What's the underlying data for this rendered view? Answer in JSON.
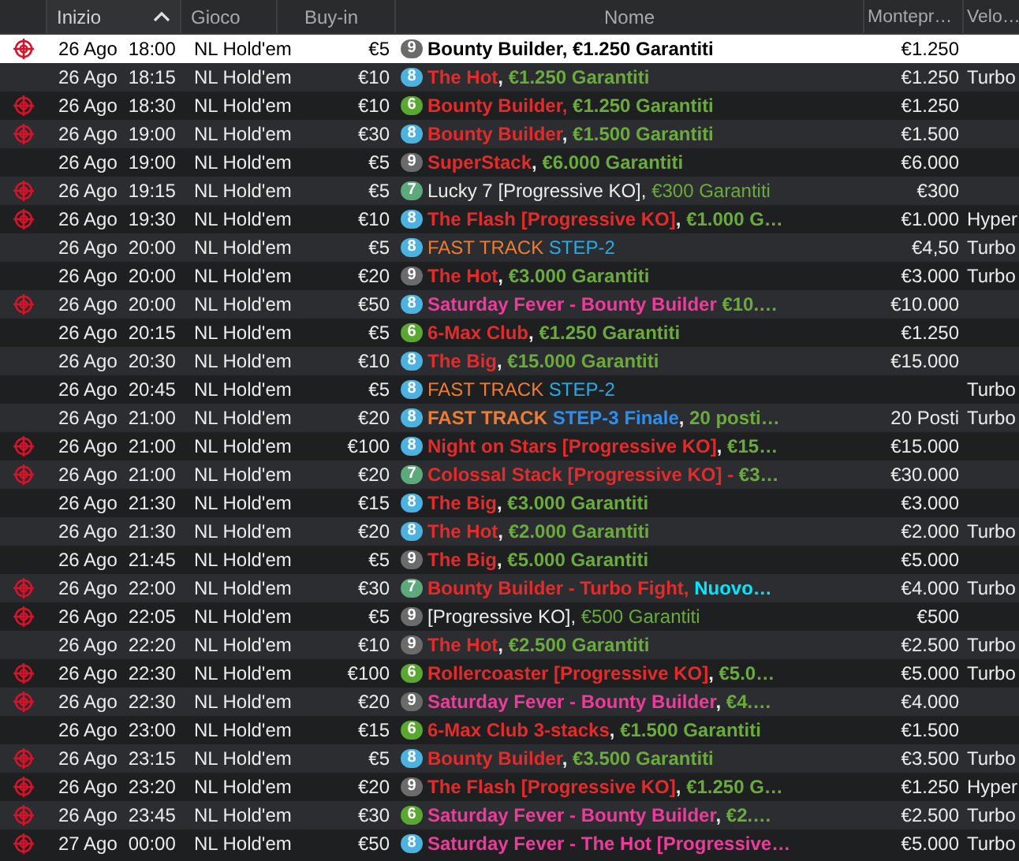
{
  "columns": [
    {
      "label": "Inizio",
      "sorted": true
    },
    {
      "label": "Gioco",
      "sorted": false
    },
    {
      "label": "Buy-in",
      "sorted": false
    },
    {
      "label": "Nome",
      "sorted": false
    },
    {
      "label": "Montepr…",
      "sorted": false
    },
    {
      "label": "Velo…",
      "sorted": false
    }
  ],
  "rows": [
    {
      "target": true,
      "selected": true,
      "date": "26 Ago",
      "time": "18:00",
      "game": "NL Hold'em",
      "buyin": "€5",
      "seats": "9",
      "color": "#6b6b6b",
      "bold": true,
      "name": [
        {
          "text": "Bounty Builder, €1.250 Garantiti"
        }
      ],
      "prize": "€1.250"
    },
    {
      "target": false,
      "selected": false,
      "date": "26 Ago",
      "time": "18:15",
      "game": "NL Hold'em",
      "buyin": "€10",
      "seats": "8",
      "color": "#4cb2e0",
      "bold": true,
      "name": [
        {
          "text": "The Hot",
          "color": "#e52a2a"
        },
        {
          "text": ", "
        },
        {
          "text": "€1.250 Garantiti",
          "color": "#6aab3a"
        }
      ],
      "prize": "€1.250",
      "speed": "Turbo"
    },
    {
      "target": true,
      "selected": false,
      "date": "26 Ago",
      "time": "18:30",
      "game": "NL Hold'em",
      "buyin": "€10",
      "seats": "6",
      "color": "#5aa832",
      "bold": true,
      "name": [
        {
          "text": "Bounty Builder, ",
          "color": "#e52a2a"
        },
        {
          "text": "€1.250 Garantiti",
          "color": "#6aab3a"
        }
      ],
      "prize": "€1.250"
    },
    {
      "target": true,
      "selected": false,
      "date": "26 Ago",
      "time": "19:00",
      "game": "NL Hold'em",
      "buyin": "€30",
      "seats": "8",
      "color": "#4cb2e0",
      "bold": true,
      "name": [
        {
          "text": "Bounty Builder",
          "color": "#e52a2a"
        },
        {
          "text": ", "
        },
        {
          "text": "€1.500 Garantiti",
          "color": "#6aab3a"
        }
      ],
      "prize": "€1.500"
    },
    {
      "target": false,
      "selected": false,
      "date": "26 Ago",
      "time": "19:00",
      "game": "NL Hold'em",
      "buyin": "€5",
      "seats": "9",
      "color": "#6b6b6b",
      "bold": true,
      "name": [
        {
          "text": "SuperStack",
          "color": "#e52a2a"
        },
        {
          "text": ", "
        },
        {
          "text": "€6.000 Garantiti",
          "color": "#6aab3a"
        }
      ],
      "prize": "€6.000"
    },
    {
      "target": true,
      "selected": false,
      "date": "26 Ago",
      "time": "19:15",
      "game": "NL Hold'em",
      "buyin": "€5",
      "seats": "7",
      "color": "#5ea97c",
      "bold": false,
      "name": [
        {
          "text": "Lucky 7 [Progressive KO], "
        },
        {
          "text": "€300 Garantiti",
          "color": "#6aab3a"
        }
      ],
      "prize": "€300"
    },
    {
      "target": true,
      "selected": false,
      "date": "26 Ago",
      "time": "19:30",
      "game": "NL Hold'em",
      "buyin": "€10",
      "seats": "8",
      "color": "#4cb2e0",
      "bold": true,
      "name": [
        {
          "text": "The Flash [Progressive KO]",
          "color": "#e52a2a"
        },
        {
          "text": ", "
        },
        {
          "text": "€1.000 G…",
          "color": "#6aab3a"
        }
      ],
      "prize": "€1.000",
      "speed": "Hyper"
    },
    {
      "target": false,
      "selected": false,
      "date": "26 Ago",
      "time": "20:00",
      "game": "NL Hold'em",
      "buyin": "€5",
      "seats": "8",
      "color": "#4cb2e0",
      "bold": false,
      "name": [
        {
          "text": "FAST TRACK ",
          "color": "#f07c30"
        },
        {
          "text": "STEP-2",
          "color": "#2aaae2"
        }
      ],
      "prize": "€4,50",
      "speed": "Turbo"
    },
    {
      "target": false,
      "selected": false,
      "date": "26 Ago",
      "time": "20:00",
      "game": "NL Hold'em",
      "buyin": "€20",
      "seats": "9",
      "color": "#6b6b6b",
      "bold": true,
      "name": [
        {
          "text": "The Hot",
          "color": "#e52a2a"
        },
        {
          "text": ", "
        },
        {
          "text": "€3.000 Garantiti",
          "color": "#6aab3a"
        }
      ],
      "prize": "€3.000",
      "speed": "Turbo"
    },
    {
      "target": true,
      "selected": false,
      "date": "26 Ago",
      "time": "20:00",
      "game": "NL Hold'em",
      "buyin": "€50",
      "seats": "8",
      "color": "#4cb2e0",
      "bold": true,
      "name": [
        {
          "text": "Saturday Fever - Bounty Builder ",
          "color": "#ee3b9b"
        },
        {
          "text": "€10.…",
          "color": "#6aab3a"
        }
      ],
      "prize": "€10.000"
    },
    {
      "target": false,
      "selected": false,
      "date": "26 Ago",
      "time": "20:15",
      "game": "NL Hold'em",
      "buyin": "€5",
      "seats": "6",
      "color": "#5aa832",
      "bold": true,
      "name": [
        {
          "text": "6-Max Club",
          "color": "#e52a2a"
        },
        {
          "text": ", "
        },
        {
          "text": "€1.250 Garantiti",
          "color": "#6aab3a"
        }
      ],
      "prize": "€1.250"
    },
    {
      "target": false,
      "selected": false,
      "date": "26 Ago",
      "time": "20:30",
      "game": "NL Hold'em",
      "buyin": "€10",
      "seats": "8",
      "color": "#4cb2e0",
      "bold": true,
      "name": [
        {
          "text": "The Big",
          "color": "#e52a2a"
        },
        {
          "text": ", "
        },
        {
          "text": "€15.000 Garantiti",
          "color": "#6aab3a"
        }
      ],
      "prize": "€15.000"
    },
    {
      "target": false,
      "selected": false,
      "date": "26 Ago",
      "time": "20:45",
      "game": "NL Hold'em",
      "buyin": "€5",
      "seats": "8",
      "color": "#4cb2e0",
      "bold": false,
      "name": [
        {
          "text": "FAST TRACK ",
          "color": "#f07c30"
        },
        {
          "text": "STEP-2",
          "color": "#2aaae2"
        }
      ],
      "speed": "Turbo"
    },
    {
      "target": false,
      "selected": false,
      "date": "26 Ago",
      "time": "21:00",
      "game": "NL Hold'em",
      "buyin": "€20",
      "seats": "8",
      "color": "#4cb2e0",
      "bold": true,
      "name": [
        {
          "text": "FAST TRACK ",
          "color": "#f07c30"
        },
        {
          "text": "STEP-3 Finale",
          "color": "#2a8ff0"
        },
        {
          "text": ", "
        },
        {
          "text": "20 posti…",
          "color": "#6aab3a"
        }
      ],
      "prize": "20 Posti",
      "speed": "Turbo"
    },
    {
      "target": true,
      "selected": false,
      "date": "26 Ago",
      "time": "21:00",
      "game": "NL Hold'em",
      "buyin": "€100",
      "seats": "8",
      "color": "#4cb2e0",
      "bold": true,
      "name": [
        {
          "text": "Night on Stars [Progressive KO]",
          "color": "#e52a2a"
        },
        {
          "text": ", "
        },
        {
          "text": "€15…",
          "color": "#6aab3a"
        }
      ],
      "prize": "€15.000"
    },
    {
      "target": true,
      "selected": false,
      "date": "26 Ago",
      "time": "21:00",
      "game": "NL Hold'em",
      "buyin": "€20",
      "seats": "7",
      "color": "#5ea97c",
      "bold": true,
      "name": [
        {
          "text": "Colossal Stack [Progressive KO] - ",
          "color": "#e52a2a"
        },
        {
          "text": "€3…",
          "color": "#6aab3a"
        }
      ],
      "prize": "€30.000"
    },
    {
      "target": false,
      "selected": false,
      "date": "26 Ago",
      "time": "21:30",
      "game": "NL Hold'em",
      "buyin": "€15",
      "seats": "8",
      "color": "#4cb2e0",
      "bold": true,
      "name": [
        {
          "text": "The Big",
          "color": "#e52a2a"
        },
        {
          "text": ", "
        },
        {
          "text": "€3.000 Garantiti",
          "color": "#6aab3a"
        }
      ],
      "prize": "€3.000"
    },
    {
      "target": false,
      "selected": false,
      "date": "26 Ago",
      "time": "21:30",
      "game": "NL Hold'em",
      "buyin": "€20",
      "seats": "8",
      "color": "#4cb2e0",
      "bold": true,
      "name": [
        {
          "text": "The Hot",
          "color": "#e52a2a"
        },
        {
          "text": ", "
        },
        {
          "text": "€2.000 Garantiti",
          "color": "#6aab3a"
        }
      ],
      "prize": "€2.000",
      "speed": "Turbo"
    },
    {
      "target": false,
      "selected": false,
      "date": "26 Ago",
      "time": "21:45",
      "game": "NL Hold'em",
      "buyin": "€5",
      "seats": "9",
      "color": "#6b6b6b",
      "bold": true,
      "name": [
        {
          "text": "The Big",
          "color": "#e52a2a"
        },
        {
          "text": ", "
        },
        {
          "text": "€5.000 Garantiti",
          "color": "#6aab3a"
        }
      ],
      "prize": "€5.000"
    },
    {
      "target": true,
      "selected": false,
      "date": "26 Ago",
      "time": "22:00",
      "game": "NL Hold'em",
      "buyin": "€30",
      "seats": "7",
      "color": "#5ea97c",
      "bold": true,
      "name": [
        {
          "text": "Bounty Builder - Turbo Fight, ",
          "color": "#e52a2a"
        },
        {
          "text": "Nuovo…",
          "color": "#00e6ff"
        }
      ],
      "prize": "€4.000",
      "speed": "Turbo"
    },
    {
      "target": true,
      "selected": false,
      "date": "26 Ago",
      "time": "22:05",
      "game": "NL Hold'em",
      "buyin": "€5",
      "seats": "9",
      "color": "#6b6b6b",
      "bold": false,
      "name": [
        {
          "text": "[Progressive KO], "
        },
        {
          "text": "€500 Garantiti",
          "color": "#6aab3a"
        }
      ],
      "prize": "€500"
    },
    {
      "target": false,
      "selected": false,
      "date": "26 Ago",
      "time": "22:20",
      "game": "NL Hold'em",
      "buyin": "€10",
      "seats": "9",
      "color": "#6b6b6b",
      "bold": true,
      "name": [
        {
          "text": "The Hot",
          "color": "#e52a2a"
        },
        {
          "text": ", "
        },
        {
          "text": "€2.500 Garantiti",
          "color": "#6aab3a"
        }
      ],
      "prize": "€2.500",
      "speed": "Turbo"
    },
    {
      "target": true,
      "selected": false,
      "date": "26 Ago",
      "time": "22:30",
      "game": "NL Hold'em",
      "buyin": "€100",
      "seats": "6",
      "color": "#5aa832",
      "bold": true,
      "name": [
        {
          "text": "Rollercoaster [Progressive KO]",
          "color": "#e52a2a"
        },
        {
          "text": ", "
        },
        {
          "text": "€5.0…",
          "color": "#6aab3a"
        }
      ],
      "prize": "€5.000",
      "speed": "Turbo"
    },
    {
      "target": true,
      "selected": false,
      "date": "26 Ago",
      "time": "22:30",
      "game": "NL Hold'em",
      "buyin": "€20",
      "seats": "9",
      "color": "#6b6b6b",
      "bold": true,
      "name": [
        {
          "text": "Saturday Fever - Bounty Builder",
          "color": "#ee3b9b"
        },
        {
          "text": ", "
        },
        {
          "text": "€4.…",
          "color": "#6aab3a"
        }
      ],
      "prize": "€4.000"
    },
    {
      "target": false,
      "selected": false,
      "date": "26 Ago",
      "time": "23:00",
      "game": "NL Hold'em",
      "buyin": "€15",
      "seats": "6",
      "color": "#5aa832",
      "bold": true,
      "name": [
        {
          "text": "6-Max Club 3-stacks",
          "color": "#e52a2a"
        },
        {
          "text": ", "
        },
        {
          "text": "€1.500 Garantiti",
          "color": "#6aab3a"
        }
      ],
      "prize": "€1.500"
    },
    {
      "target": true,
      "selected": false,
      "date": "26 Ago",
      "time": "23:15",
      "game": "NL Hold'em",
      "buyin": "€5",
      "seats": "8",
      "color": "#4cb2e0",
      "bold": true,
      "name": [
        {
          "text": "Bounty Builder",
          "color": "#e52a2a"
        },
        {
          "text": ", "
        },
        {
          "text": "€3.500 Garantiti",
          "color": "#6aab3a"
        }
      ],
      "prize": "€3.500",
      "speed": "Turbo"
    },
    {
      "target": true,
      "selected": false,
      "date": "26 Ago",
      "time": "23:20",
      "game": "NL Hold'em",
      "buyin": "€20",
      "seats": "9",
      "color": "#6b6b6b",
      "bold": true,
      "name": [
        {
          "text": "The Flash [Progressive KO]",
          "color": "#e52a2a"
        },
        {
          "text": ", "
        },
        {
          "text": "€1.250 G…",
          "color": "#6aab3a"
        }
      ],
      "prize": "€1.250",
      "speed": "Hyper"
    },
    {
      "target": true,
      "selected": false,
      "date": "26 Ago",
      "time": "23:45",
      "game": "NL Hold'em",
      "buyin": "€30",
      "seats": "6",
      "color": "#5aa832",
      "bold": true,
      "name": [
        {
          "text": "Saturday Fever - Bounty Builder",
          "color": "#ee3b9b"
        },
        {
          "text": ", "
        },
        {
          "text": "€2.…",
          "color": "#6aab3a"
        }
      ],
      "prize": "€2.500",
      "speed": "Turbo"
    },
    {
      "target": true,
      "selected": false,
      "date": "27 Ago",
      "time": "00:00",
      "game": "NL Hold'em",
      "buyin": "€50",
      "seats": "8",
      "color": "#4cb2e0",
      "bold": true,
      "name": [
        {
          "text": "Saturday Fever - The Hot [Progressive…",
          "color": "#ee3b9b"
        }
      ],
      "prize": "€5.000",
      "speed": "Turbo"
    }
  ]
}
